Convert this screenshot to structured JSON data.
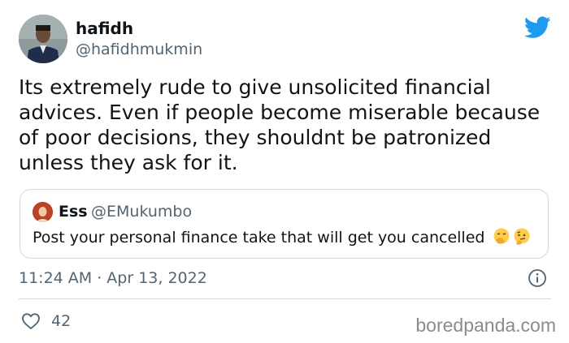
{
  "tweet": {
    "author": {
      "display_name": "hafidh",
      "handle": "@hafidhmukmin"
    },
    "text_lines": [
      "Its extremely rude to give unsolicited financial",
      "advices. Even if people become miserable because",
      "of poor decisions, they shouldnt be patronized",
      "unless they ask for it."
    ],
    "quoted": {
      "display_name": "Ess",
      "handle": "@EMukumbo",
      "text": "Post your personal finance take that will get you cancelled",
      "emojis": [
        "face-with-hand-over-mouth-icon",
        "thinking-face-icon"
      ]
    },
    "timestamp": "11:24 AM · Apr 13, 2022",
    "likes": "42"
  },
  "brand": {
    "twitter_blue": "#1d9bf0",
    "watermark": "boredpanda.com"
  }
}
